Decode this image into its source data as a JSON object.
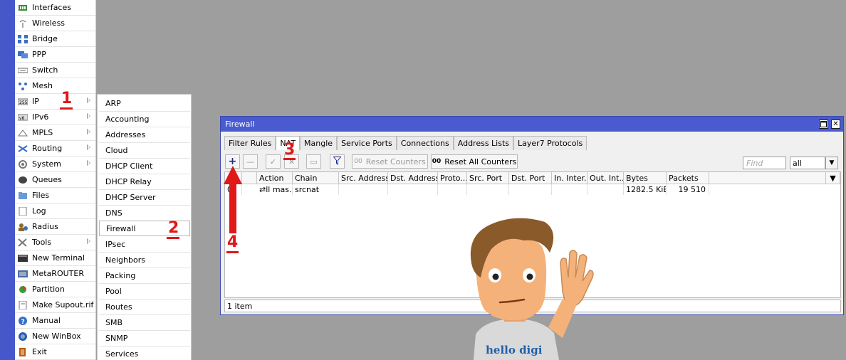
{
  "main_menu": {
    "items": [
      {
        "label": "Interfaces",
        "icon": "interfaces-icon"
      },
      {
        "label": "Wireless",
        "icon": "wireless-icon"
      },
      {
        "label": "Bridge",
        "icon": "bridge-icon"
      },
      {
        "label": "PPP",
        "icon": "ppp-icon"
      },
      {
        "label": "Switch",
        "icon": "switch-icon"
      },
      {
        "label": "Mesh",
        "icon": "mesh-icon"
      },
      {
        "label": "IP",
        "icon": "ip-icon",
        "submenu": true
      },
      {
        "label": "IPv6",
        "icon": "ipv6-icon",
        "submenu": true
      },
      {
        "label": "MPLS",
        "icon": "mpls-icon",
        "submenu": true
      },
      {
        "label": "Routing",
        "icon": "routing-icon",
        "submenu": true
      },
      {
        "label": "System",
        "icon": "system-icon",
        "submenu": true
      },
      {
        "label": "Queues",
        "icon": "queues-icon"
      },
      {
        "label": "Files",
        "icon": "files-icon"
      },
      {
        "label": "Log",
        "icon": "log-icon"
      },
      {
        "label": "Radius",
        "icon": "radius-icon"
      },
      {
        "label": "Tools",
        "icon": "tools-icon",
        "submenu": true
      },
      {
        "label": "New Terminal",
        "icon": "terminal-icon"
      },
      {
        "label": "MetaROUTER",
        "icon": "metarouter-icon"
      },
      {
        "label": "Partition",
        "icon": "partition-icon"
      },
      {
        "label": "Make Supout.rif",
        "icon": "supout-icon"
      },
      {
        "label": "Manual",
        "icon": "manual-icon"
      },
      {
        "label": "New WinBox",
        "icon": "winbox-icon"
      },
      {
        "label": "Exit",
        "icon": "exit-icon"
      }
    ]
  },
  "ip_submenu": {
    "items": [
      "ARP",
      "Accounting",
      "Addresses",
      "Cloud",
      "DHCP Client",
      "DHCP Relay",
      "DHCP Server",
      "DNS",
      "Firewall",
      "IPsec",
      "Neighbors",
      "Packing",
      "Pool",
      "Routes",
      "SMB",
      "SNMP",
      "Services"
    ],
    "selected": "Firewall"
  },
  "annotations": {
    "step1": "1",
    "step2": "2",
    "step3": "3",
    "step4": "4",
    "color": "#e01818"
  },
  "firewall": {
    "title": "Firewall",
    "tabs": [
      "Filter Rules",
      "NAT",
      "Mangle",
      "Service Ports",
      "Connections",
      "Address Lists",
      "Layer7 Protocols"
    ],
    "active_tab": "NAT",
    "toolbar": {
      "add": "+",
      "remove": "—",
      "enable": "✓",
      "disable": "✕",
      "comment": "▭",
      "filter": "filter-icon",
      "reset_counters": "Reset Counters",
      "reset_all_counters": "Reset All Counters",
      "counter_prefix": "00"
    },
    "find_placeholder": "Find",
    "filter_value": "all",
    "columns": [
      "",
      "",
      "Action",
      "Chain",
      "Src. Address",
      "Dst. Address",
      "Proto...",
      "Src. Port",
      "Dst. Port",
      "In. Inter...",
      "Out. Int...",
      "Bytes",
      "Packets"
    ],
    "rows": [
      {
        "num": "0",
        "action": "⇄ll mas...",
        "chain": "srcnat",
        "src_address": "",
        "dst_address": "",
        "proto": "",
        "src_port": "",
        "dst_port": "",
        "in_interface": "",
        "out_interface": "",
        "bytes": "1282.5 KiB",
        "packets": "19 510"
      }
    ],
    "status": "1 item"
  },
  "mascot": {
    "shirt_text": "hello digi"
  },
  "colors": {
    "title_bar": "#4a5bd0",
    "strip": "#4658c9",
    "desktop": "#9e9e9e",
    "accent_red": "#e01818"
  }
}
